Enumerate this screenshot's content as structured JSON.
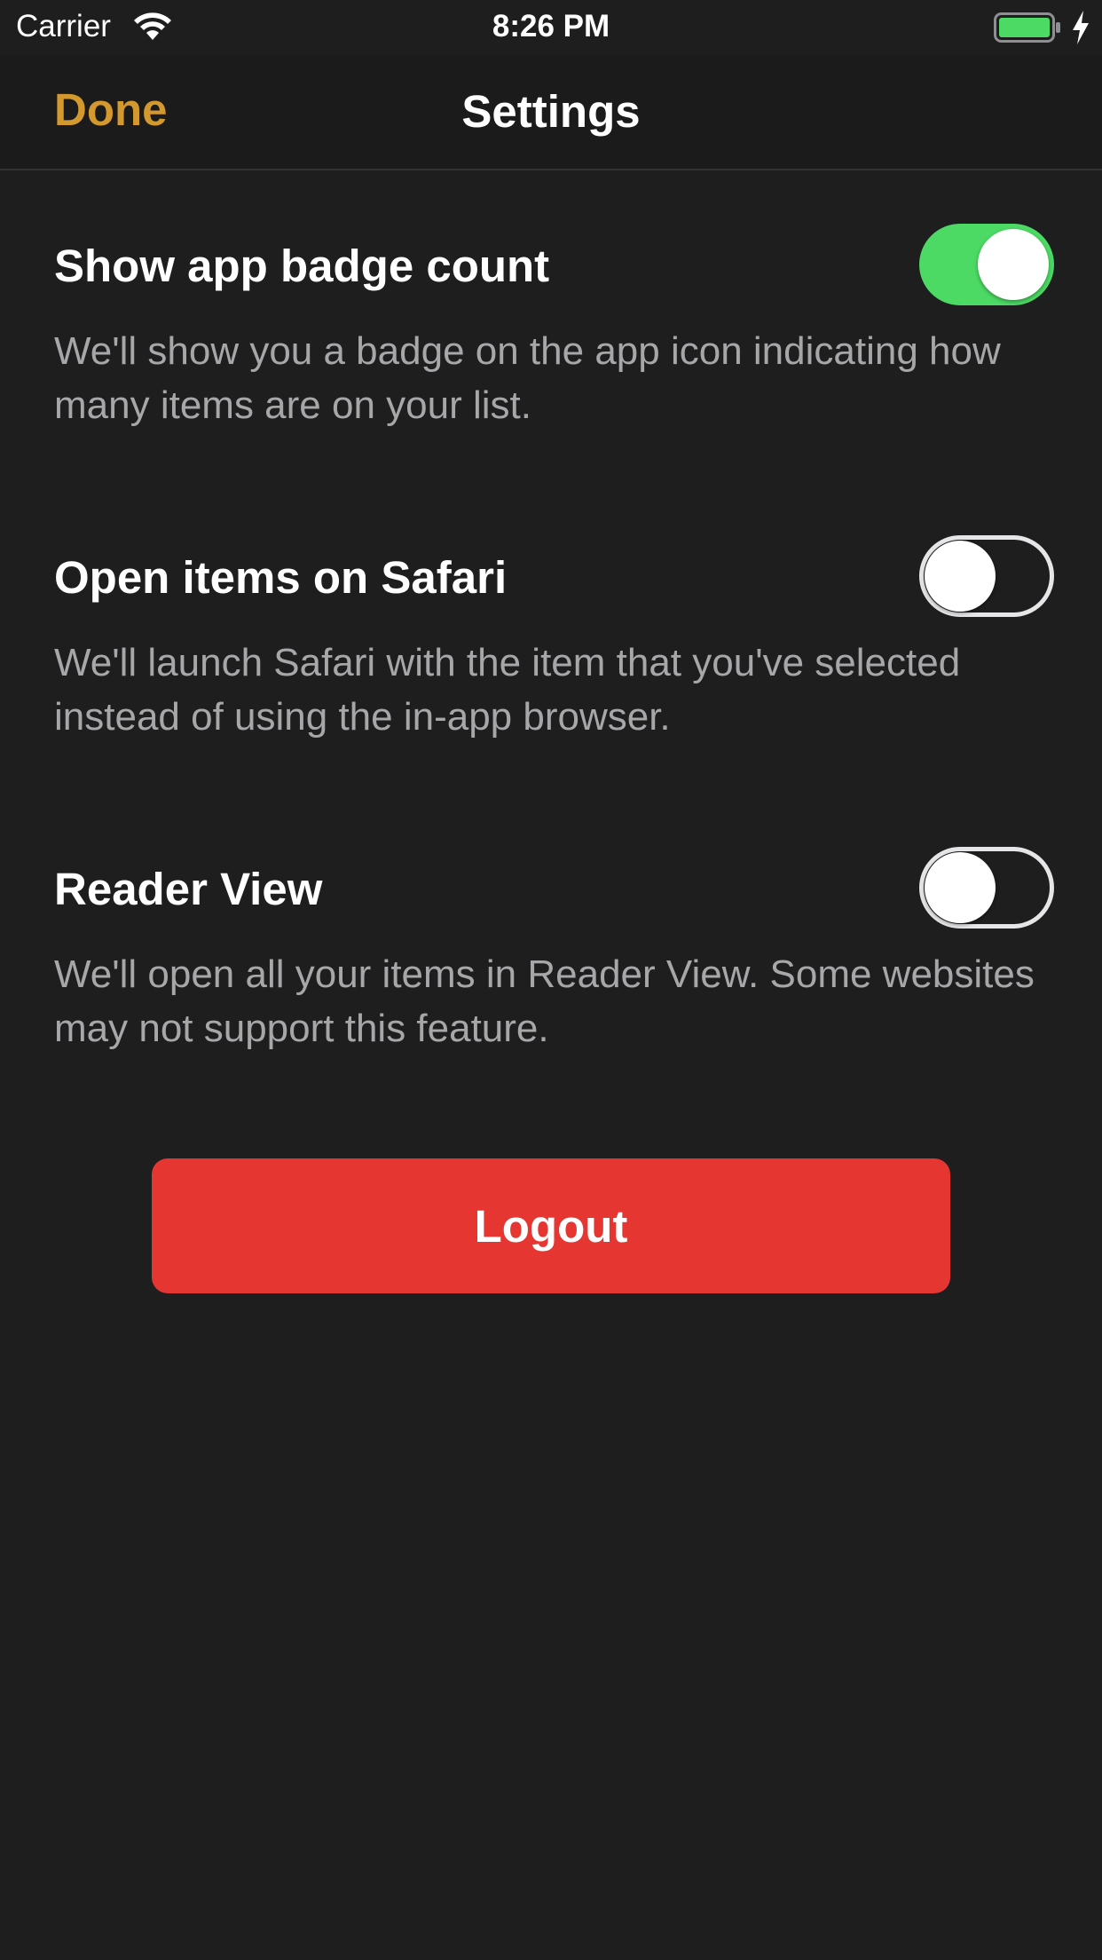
{
  "status_bar": {
    "carrier": "Carrier",
    "time": "8:26 PM",
    "battery_color": "#4cd964"
  },
  "nav": {
    "done_label": "Done",
    "title": "Settings",
    "accent_color": "#d3992e"
  },
  "settings": [
    {
      "title": "Show app badge count",
      "description": "We'll show you a badge on the app icon indicating how many items are on your list.",
      "enabled": true
    },
    {
      "title": "Open items on Safari",
      "description": "We'll launch Safari with the item that you've selected instead of using the in-app browser.",
      "enabled": false
    },
    {
      "title": "Reader View",
      "description": "We'll open all your items in Reader View. Some websites may not support this feature.",
      "enabled": false
    }
  ],
  "logout": {
    "label": "Logout",
    "color": "#e53631"
  },
  "colors": {
    "background": "#1e1e1f",
    "toggle_on": "#4cd964"
  }
}
